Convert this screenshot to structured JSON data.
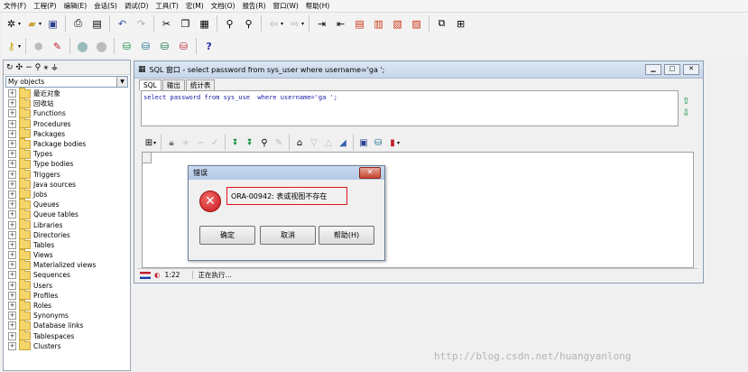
{
  "menu": [
    "文件(F)",
    "工程(P)",
    "编辑(E)",
    "会话(S)",
    "调试(D)",
    "工具(T)",
    "宏(M)",
    "文档(O)",
    "报告(R)",
    "窗口(W)",
    "帮助(H)"
  ],
  "left_panel": {
    "filter_label": "My objects",
    "tree_items": [
      "最近对象",
      "回收站",
      "Functions",
      "Procedures",
      "Packages",
      "Package bodies",
      "Types",
      "Type bodies",
      "Triggers",
      "Java sources",
      "Jobs",
      "Queues",
      "Queue tables",
      "Libraries",
      "Directories",
      "Tables",
      "Views",
      "Materialized views",
      "Sequences",
      "Users",
      "Profiles",
      "Roles",
      "Synonyms",
      "Database links",
      "Tablespaces",
      "Clusters"
    ]
  },
  "sql_window": {
    "title": "SQL 窗口 - select password from sys_user where username='ga  ';",
    "tabs": [
      "SQL",
      "输出",
      "统计表"
    ],
    "sql_text": "select password from sys_use  where username='ga ';",
    "status": {
      "position": "1:22",
      "state": "正在执行..."
    }
  },
  "dialog": {
    "title": "错误",
    "message": "ORA-00942: 表或视图不存在",
    "buttons": {
      "ok": "确定",
      "cancel": "取消",
      "help": "帮助(H)"
    }
  },
  "watermark": "http://blog.csdn.net/huangyanlong",
  "colors": {
    "error_red": "#e0141e",
    "sql_text": "#1a1aa8",
    "title_bar": "#c7d6ea"
  }
}
